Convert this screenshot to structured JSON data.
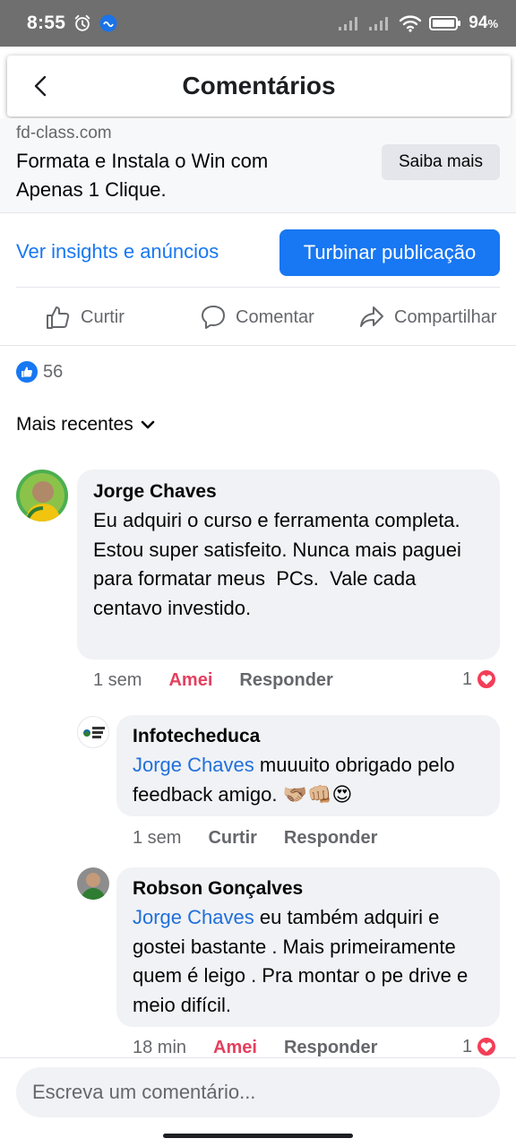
{
  "status_bar": {
    "time": "8:55",
    "battery": "94"
  },
  "header": {
    "title": "Comentários"
  },
  "ad": {
    "domain": "fd-class.com",
    "headline": "Formata e Instala o Win com Apenas 1 Clique.",
    "cta_label": "Saiba mais"
  },
  "insights": {
    "link_label": "Ver insights e anúncios",
    "boost_label": "Turbinar publicação"
  },
  "actions": {
    "like": "Curtir",
    "comment": "Comentar",
    "share": "Compartilhar"
  },
  "reactions": {
    "count": "56"
  },
  "sort": {
    "label": "Mais recentes"
  },
  "comments": [
    {
      "author": "Jorge Chaves",
      "text": "Eu adquiri o curso e ferramenta completa. Estou super satisfeito. Nunca mais paguei para formatar meus  PCs.  Vale cada centavo investido.",
      "time": "1 sem",
      "reaction_label": "Amei",
      "reply_label": "Responder",
      "reaction_count": "1",
      "replies": [
        {
          "author": "Infotecheduca",
          "mention": "Jorge Chaves",
          "text": " muuuito obrigado pelo feedback amigo. 🫱🏼‍🫲🏽👊🏼😍",
          "time": "1 sem",
          "reaction_label": "Curtir",
          "reply_label": "Responder"
        },
        {
          "author": "Robson Gonçalves",
          "mention": "Jorge Chaves",
          "text": " eu também adquiri e gostei bastante . Mais primeiramente quem é leigo . Pra montar o pe drive e meio difícil.",
          "time": "18 min",
          "reaction_label": "Amei",
          "reply_label": "Responder",
          "reaction_count": "1"
        }
      ]
    }
  ],
  "composer": {
    "placeholder": "Escreva um comentário..."
  },
  "colors": {
    "brand_blue": "#1877f2",
    "love_red": "#e4405f",
    "status_bar": "#6f6f6f"
  }
}
